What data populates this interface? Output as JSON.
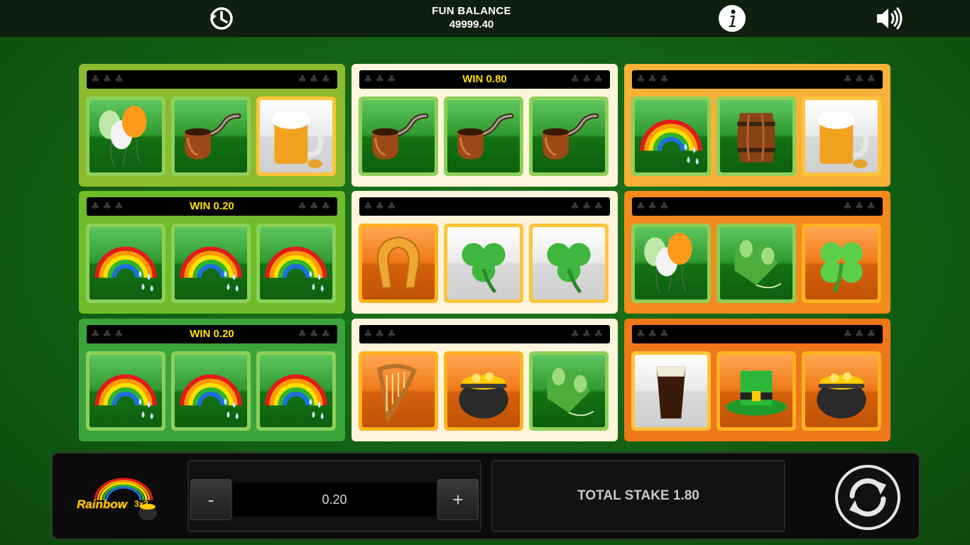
{
  "topbar": {
    "history_icon": "history-icon",
    "balance_label": "FUN BALANCE",
    "balance_value": "49999.40",
    "info_icon": "info-icon",
    "sound_icon": "speaker-icon"
  },
  "panels": [
    {
      "win": "",
      "frame": "#8dbb2e",
      "symbols": [
        "balloons",
        "pipe",
        "beer-mug"
      ],
      "cell_bgs": [
        "green",
        "green",
        "white"
      ]
    },
    {
      "win": "WIN 0.80",
      "frame": "#fff5dc",
      "symbols": [
        "pipe",
        "pipe",
        "pipe"
      ],
      "cell_bgs": [
        "green",
        "green",
        "green"
      ]
    },
    {
      "win": "",
      "frame": "#f6b136",
      "symbols": [
        "rainbow",
        "barrel",
        "beer-mug"
      ],
      "cell_bgs": [
        "green",
        "green",
        "white"
      ]
    },
    {
      "win": "WIN 0.20",
      "frame": "#6ebd28",
      "symbols": [
        "rainbow",
        "rainbow",
        "rainbow"
      ],
      "cell_bgs": [
        "green",
        "green",
        "green"
      ]
    },
    {
      "win": "",
      "frame": "#fff5dc",
      "symbols": [
        "horseshoe",
        "shamrock",
        "shamrock"
      ],
      "cell_bgs": [
        "orange",
        "white",
        "white"
      ]
    },
    {
      "win": "",
      "frame": "#f58a1c",
      "symbols": [
        "balloons",
        "hops",
        "clover"
      ],
      "cell_bgs": [
        "green",
        "green",
        "orange"
      ]
    },
    {
      "win": "WIN 0.20",
      "frame": "#3aa33a",
      "symbols": [
        "rainbow",
        "rainbow",
        "rainbow"
      ],
      "cell_bgs": [
        "green",
        "green",
        "green"
      ]
    },
    {
      "win": "",
      "frame": "#fff5dc",
      "symbols": [
        "harp",
        "pot-of-gold",
        "hops"
      ],
      "cell_bgs": [
        "orange",
        "orange",
        "green"
      ]
    },
    {
      "win": "",
      "frame": "#f0761a",
      "symbols": [
        "stout-glass",
        "leprechaun-hat",
        "pot-of-gold"
      ],
      "cell_bgs": [
        "white",
        "orange",
        "orange"
      ]
    }
  ],
  "bottom": {
    "logo_text": "Rainbow",
    "logo_suffix": "3x3",
    "minus_label": "-",
    "plus_label": "+",
    "stake_value": "0.20",
    "total_stake": "TOTAL STAKE 1.80",
    "spin_icon": "spin-icon"
  },
  "colors": {
    "win_text": "#ffe000",
    "panel_header": "#000000",
    "bar_background": "#0b0b0b"
  }
}
